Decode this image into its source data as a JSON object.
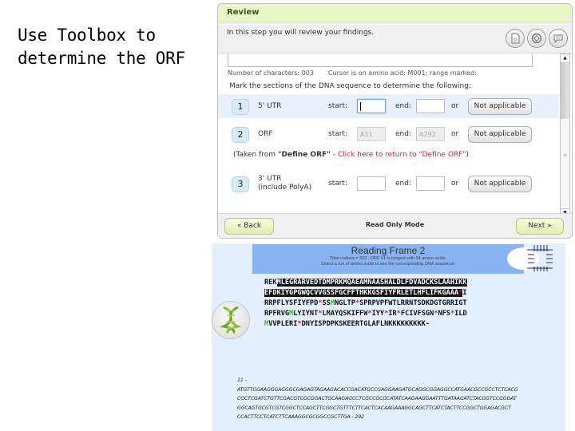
{
  "slide": {
    "title": "Use Toolbox to\ndetermine the ORF"
  },
  "window": {
    "header": "Review",
    "description": "In this step you will review your findings.",
    "icons": [
      "document-icon",
      "lifebuoy-icon",
      "chat-icon"
    ],
    "char_count_label": "Number of characters: 003",
    "cursor_label": "Cursor is on amino acid: M001;  range marked:",
    "instruction": "Mark the sections of the DNA sequence to determine the following:",
    "rows": [
      {
        "num": "1",
        "label": "5' UTR",
        "sublabel": "",
        "start_label": "start:",
        "start_value": "",
        "end_label": "end:",
        "end_value": "",
        "or_label": "or",
        "button": "Not applicable"
      },
      {
        "num": "2",
        "label": "ORF",
        "sublabel": "",
        "start_label": "start:",
        "start_value": "A11",
        "end_label": "end:",
        "end_value": "A292",
        "or_label": "or",
        "button": "Not applicable"
      },
      {
        "num": "3",
        "label": "3' UTR",
        "sublabel": "(include PolyA)",
        "start_label": "start:",
        "start_value": "",
        "end_label": "end:",
        "end_value": "",
        "or_label": "or",
        "button": "Not applicable"
      }
    ],
    "taken_prefix": "(Taken from ",
    "taken_bold": "\"Define ORF\"",
    "taken_dash": " - ",
    "taken_link": "Click here to return to \"Define ORF\"",
    "taken_suffix": ")",
    "footer": {
      "back": "«  Back",
      "mode": "Read Only Mode",
      "next": "Next  »"
    }
  },
  "reading_frame": {
    "title": "Reading Frame 2",
    "line1": "Total codons = 293 . ORF #1 is longest with 94 amino acids.",
    "line2": "Select a run of amino acids to see the corresponding DNA sequence.",
    "protein": [
      [
        {
          "t": "REK",
          "c": ""
        },
        {
          "t": "MLEGRARVEDTDMPRKMQAEAMNAASHALDLFDVADCKSLAAHIKK",
          "c": "hl"
        }
      ],
      [
        {
          "t": "EFDKIYGPGWQCVVGSSFGCFFTHKKGSFIYFRLETLHFLIFKGAAA",
          "c": "hl"
        },
        {
          "t": "*",
          "c": "hl st"
        },
        {
          "t": "I",
          "c": ""
        }
      ],
      [
        {
          "t": "RRPFLYSFIYFPD",
          "c": ""
        },
        {
          "t": "*",
          "c": "st"
        },
        {
          "t": "SS",
          "c": ""
        },
        {
          "t": "M",
          "c": "m"
        },
        {
          "t": "NGLTP",
          "c": ""
        },
        {
          "t": "*",
          "c": "st"
        },
        {
          "t": "SPRPVPFWTLRRNTSDKDGTGRRIGT",
          "c": ""
        }
      ],
      [
        {
          "t": "RPFRVG",
          "c": ""
        },
        {
          "t": "M",
          "c": "m"
        },
        {
          "t": "LYIYNT",
          "c": ""
        },
        {
          "t": "*",
          "c": "st"
        },
        {
          "t": "LMAYQSKIFFW",
          "c": ""
        },
        {
          "t": "*",
          "c": "st"
        },
        {
          "t": "IYY",
          "c": ""
        },
        {
          "t": "*",
          "c": "st"
        },
        {
          "t": "IR",
          "c": ""
        },
        {
          "t": "*",
          "c": "st"
        },
        {
          "t": "FCIVFSGN",
          "c": ""
        },
        {
          "t": "*",
          "c": "st"
        },
        {
          "t": "NFS",
          "c": ""
        },
        {
          "t": "*",
          "c": "st"
        },
        {
          "t": "ILD",
          "c": ""
        }
      ],
      [
        {
          "t": "M",
          "c": "m"
        },
        {
          "t": "VVPLERI",
          "c": ""
        },
        {
          "t": "*",
          "c": "st"
        },
        {
          "t": "DNYISPDPKSKEERTGLAFLNKKKKKKKKK-",
          "c": ""
        }
      ]
    ],
    "dna_header": "11 -",
    "dna": [
      "ATGTTGGAAGGGAGGGCGAGAGTAGAAGACACCGACATGCCGAGGAAGATGCAGGCGGAGGCCATGAACGCCGCCTCTCACG",
      "CGCTCGATCTGTTCGACGTCGCGGACTGCAAGAGCCTCGCCGCGCATATCAAGAAGGAATTTGATAAGATCTACGGTCCGGGAT",
      "GGCAGTGCGTCGTCGGCTCCAGCTTCGGCTGTTTCTTCACTCACAAGAAAGGCAGCTTCATCTACTTCCGGCTGGAGACGCT",
      "CCACTTCCTCATCTTCAAAGGCGCGGCCGCTTGA - 292"
    ]
  },
  "colors": {
    "header_green": "#e9f7c4",
    "link_red": "#d4202a",
    "frame_blue": "#88b2f1",
    "stop_red": "#c2244f",
    "start_green": "#2fbe32"
  }
}
